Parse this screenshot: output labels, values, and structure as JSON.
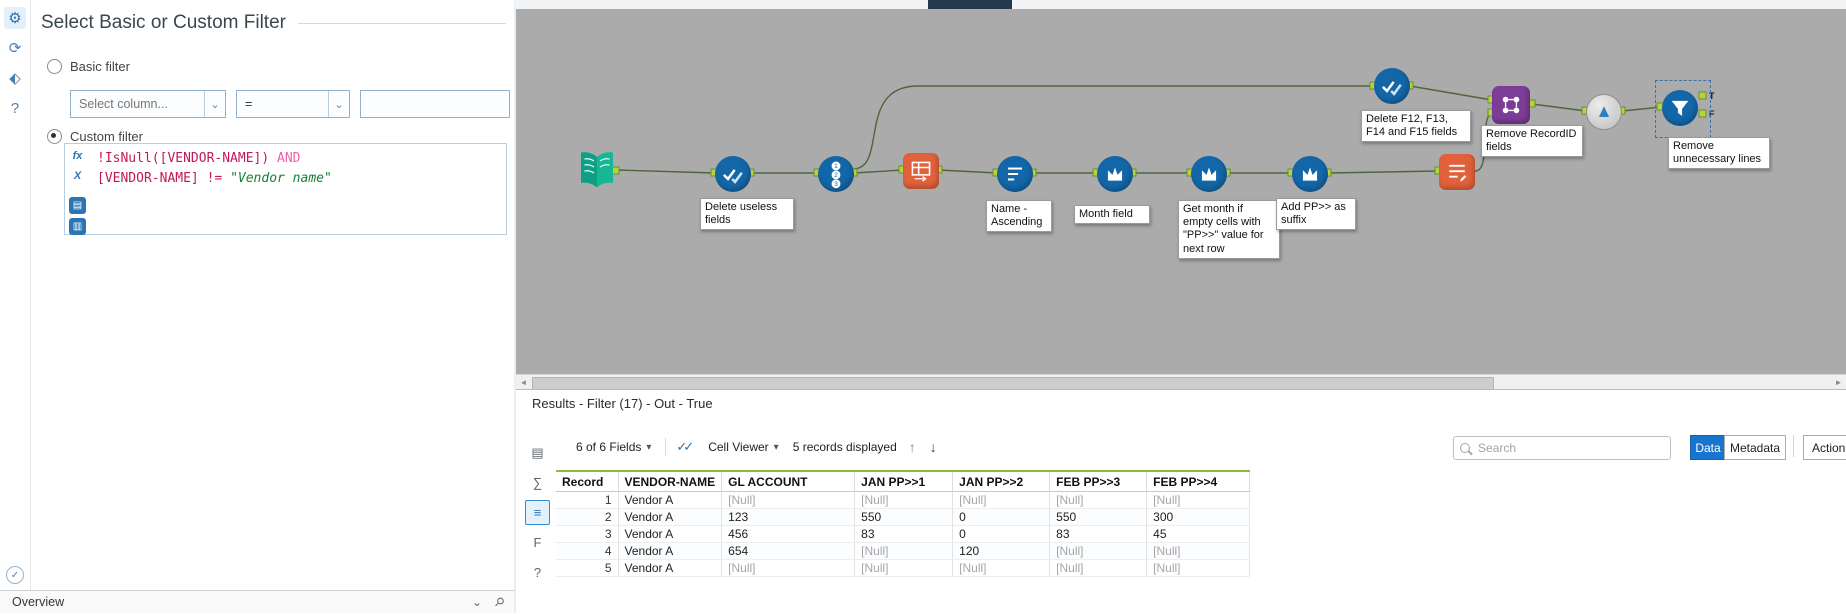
{
  "icons": {
    "gear": "⚙",
    "refresh": "⟳",
    "tag": "⬖",
    "help": "?",
    "check": "✓",
    "chevron_down": "⌄",
    "caret": "▾",
    "pin": "⚲",
    "fx": "fx",
    "variables": "X",
    "folder": "▤",
    "save": "▥",
    "up_arrow": "↑",
    "down_arrow": "↓",
    "double_check": "✓✓",
    "sheets": "▤",
    "sigma": "∑",
    "doc": "≡",
    "f_doc": "F",
    "question": "?",
    "scroll_left": "◄",
    "scroll_right": "►"
  },
  "left_panel": {
    "title": "Select Basic or Custom Filter",
    "basic": {
      "label": "Basic filter",
      "column_placeholder": "Select column...",
      "operator": "="
    },
    "custom": {
      "label": "Custom filter"
    },
    "expression": {
      "line1_code": "!IsNull([VENDOR-NAME])",
      "line1_op": " AND",
      "line2_code": "[VENDOR-NAME] != ",
      "line2_str": "\"Vendor name\""
    },
    "footer": {
      "overview": "Overview"
    }
  },
  "canvas": {
    "record_id_digits": [
      "1",
      "2",
      "3"
    ],
    "anchors": {
      "t": "T",
      "f": "F"
    },
    "tools": {
      "select1": {
        "label": "Delete useless fields"
      },
      "sort": {
        "label": "Name - Ascending"
      },
      "f1": {
        "label": "Month field"
      },
      "f2": {
        "label": "Get month if empty cells with \"PP>>\" value for next row"
      },
      "f3": {
        "label": "Add PP>> as suffix"
      },
      "select2": {
        "label": "Delete F12, F13, F14 and F15 fields"
      },
      "join": {
        "label": "Remove RecordID fields"
      },
      "filter": {
        "label": "Remove unnecessary lines"
      }
    }
  },
  "results": {
    "title": "Results - Filter (17) - Out - True",
    "toolbar": {
      "fields": "6 of 6 Fields",
      "cell_viewer": "Cell Viewer",
      "records": "5 records displayed",
      "search_placeholder": "Search",
      "data": "Data",
      "metadata": "Metadata",
      "action": "Action"
    },
    "table": {
      "columns": [
        "Record",
        "VENDOR-NAME",
        "GL ACCOUNT",
        "JAN PP>>1",
        "JAN PP>>2",
        "FEB PP>>3",
        "FEB PP>>4"
      ],
      "rows": [
        [
          "1",
          "Vendor A",
          "[Null]",
          "[Null]",
          "[Null]",
          "[Null]",
          "[Null]"
        ],
        [
          "2",
          "Vendor A",
          "123",
          "550",
          "0",
          "550",
          "300"
        ],
        [
          "3",
          "Vendor A",
          "456",
          "83",
          "0",
          "83",
          "45"
        ],
        [
          "4",
          "Vendor A",
          "654",
          "[Null]",
          "120",
          "[Null]",
          "[Null]"
        ],
        [
          "5",
          "Vendor A",
          "[Null]",
          "[Null]",
          "[Null]",
          "[Null]",
          "[Null]"
        ]
      ]
    }
  }
}
